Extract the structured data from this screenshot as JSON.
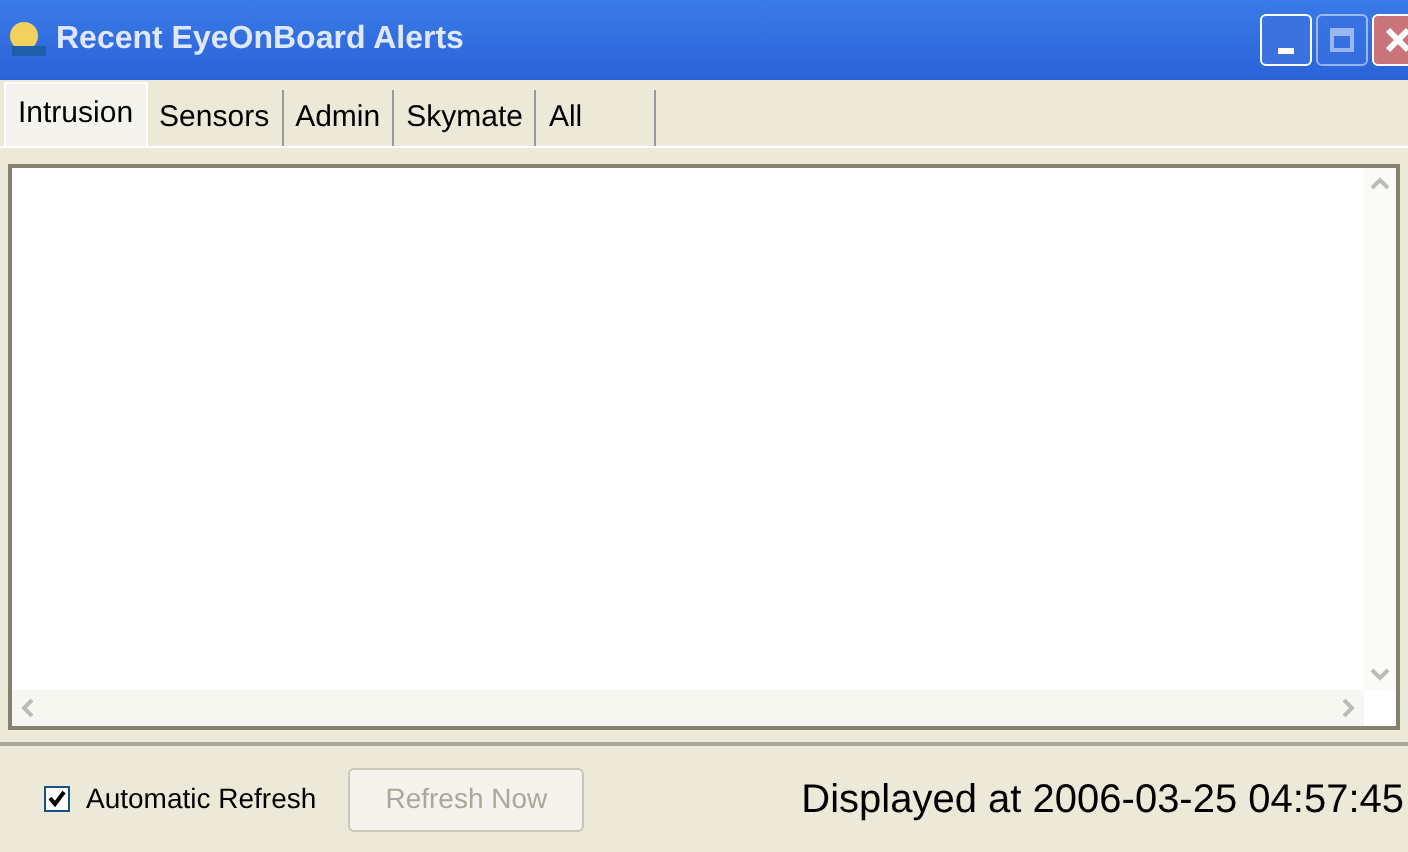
{
  "window": {
    "title": "Recent EyeOnBoard Alerts",
    "buttons": [
      {
        "kind": "minimize",
        "disabled": false
      },
      {
        "kind": "maximize",
        "disabled": true
      },
      {
        "kind": "close",
        "disabled": false
      }
    ]
  },
  "tabs": [
    {
      "label": "Intrusion",
      "selected": true
    },
    {
      "label": "Sensors",
      "selected": false
    },
    {
      "label": "Admin",
      "selected": false
    },
    {
      "label": "Skymate",
      "selected": false
    },
    {
      "label": "All",
      "selected": false
    }
  ],
  "auto_refresh": {
    "label": "Automatic Refresh",
    "checked": true
  },
  "refresh_button": {
    "label": "Refresh Now",
    "disabled": true
  },
  "status": "Displayed at 2006-03-25 04:57:45"
}
